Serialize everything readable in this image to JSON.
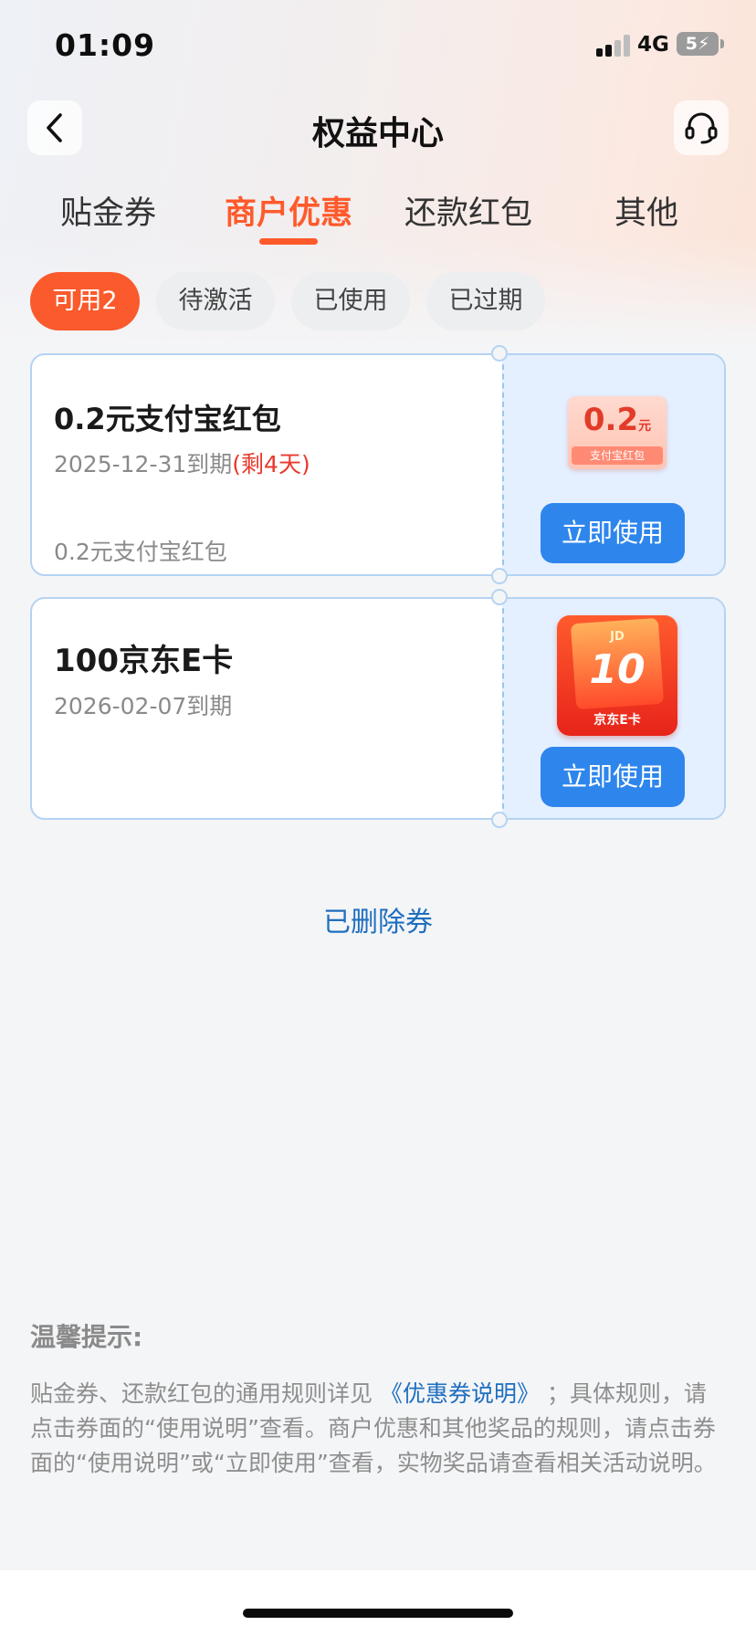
{
  "status_bar": {
    "time": "01:09",
    "network": "4G",
    "battery": "5"
  },
  "nav": {
    "title": "权益中心",
    "back_icon": "chevron-left-icon",
    "service_icon": "headset-icon"
  },
  "tabs": [
    {
      "label": "贴金券",
      "active": false
    },
    {
      "label": "商户优惠",
      "active": true
    },
    {
      "label": "还款红包",
      "active": false
    },
    {
      "label": "其他",
      "active": false
    }
  ],
  "filters": [
    {
      "label": "可用2",
      "active": true
    },
    {
      "label": "待激活",
      "active": false
    },
    {
      "label": "已使用",
      "active": false
    },
    {
      "label": "已过期",
      "active": false
    }
  ],
  "coupons": [
    {
      "title": "0.2元支付宝红包",
      "expiry": "2025-12-31到期",
      "remaining": "(剩4天)",
      "desc": "0.2元支付宝红包",
      "art_amount": "0.2",
      "art_unit": "元",
      "art_label": "支付宝红包",
      "button": "立即使用"
    },
    {
      "title": "100京东E卡",
      "expiry": "2026-02-07到期",
      "art_brand": "JD",
      "art_amount": "10",
      "art_label": "京东E卡",
      "button": "立即使用"
    }
  ],
  "deleted_link": "已删除券",
  "tips": {
    "title": "温馨提示:",
    "text_before": "贴金券、还款红包的通用规则详见 ",
    "link": "《优惠券说明》",
    "text_after": " ；具体规则，请点击券面的“使用说明”查看。商户优惠和其他奖品的规则，请点击券面的“使用说明”或“立即使用”查看，实物奖品请查看相关活动说明。"
  },
  "colors": {
    "accent": "#ff5a2c",
    "button_blue": "#2e86ec",
    "link_blue": "#1f6fbf",
    "warning_red": "#e8392c"
  }
}
